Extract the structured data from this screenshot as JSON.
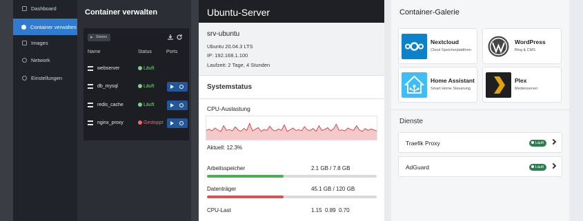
{
  "sidebar": {
    "items": [
      {
        "label": "Dashboard",
        "active": false
      },
      {
        "label": "Container verwalten",
        "active": true
      },
      {
        "label": "Images",
        "active": false
      },
      {
        "label": "Network",
        "active": false
      },
      {
        "label": "Einstellungen",
        "active": false
      }
    ]
  },
  "containers": {
    "title": "Container verwalten",
    "start_button": "Starten",
    "headers": {
      "name": "Name",
      "status": "Status",
      "ports": "Ports"
    },
    "rows": [
      {
        "name": "webserver",
        "status": "Läuft",
        "state": "ok"
      },
      {
        "name": "db_mysql",
        "status": "Läuft",
        "state": "ok"
      },
      {
        "name": "redis_cache",
        "status": "Läuft",
        "state": "ok"
      },
      {
        "name": "nginx_proxy",
        "status": "Gestoppt",
        "state": "bad"
      }
    ]
  },
  "server": {
    "header": "Ubuntu-Server",
    "name": "srv-ubuntu",
    "os": "Ubuntu 20.04.3 LTS",
    "ip": "IP: 192.168.1.100",
    "uptime": "Laufzeit: 2 Tage, 4 Stunden"
  },
  "status": {
    "title": "Systemstatus",
    "cpu_title": "CPU-Auslastung",
    "cpu_current": "Aktuell: 12.3%",
    "cpu_history": [
      40,
      45,
      38,
      50,
      42,
      35,
      60,
      40,
      44,
      38,
      55,
      42,
      36,
      48,
      40,
      70,
      38,
      45,
      52,
      36,
      44,
      40,
      58,
      42,
      38,
      46,
      40,
      64,
      36,
      42,
      50,
      40,
      44,
      38,
      56,
      42,
      40,
      48,
      36,
      60,
      40,
      44,
      52,
      38,
      46,
      66,
      40,
      42,
      38,
      50,
      44,
      40,
      60,
      42,
      36,
      48,
      40,
      46,
      42,
      38
    ],
    "memory_label": "Arbeitsspeicher",
    "memory_value": "2.1 GB / 7.8 GB",
    "memory_fraction": 0.45,
    "memory_color": "#4caf50",
    "disk_label": "Datenträger",
    "disk_value": "45.1 GB / 120 GB",
    "disk_fraction": 0.45,
    "disk_color": "#d9534f",
    "load_label": "CPU-Last",
    "load_value": "1.15  0.89  0.70"
  },
  "gallery": {
    "title": "Container-Galerie",
    "apps": [
      {
        "name": "Nextcloud",
        "desc": "Cloud Speicherplattform",
        "icon": "nextcloud-logo"
      },
      {
        "name": "WordPress",
        "desc": "Blog & CMS",
        "icon": "wordpress-logo"
      },
      {
        "name": "Home Assistant",
        "desc": "Smart Home Steuerung",
        "icon": "home-assistant-logo"
      },
      {
        "name": "Plex",
        "desc": "Medienserver",
        "icon": "plex-logo"
      }
    ]
  },
  "services": {
    "title": "Dienste",
    "items": [
      {
        "name": "Traefik Proxy",
        "status": "Läuft"
      },
      {
        "name": "AdGuard",
        "status": "Läuft"
      }
    ]
  }
}
